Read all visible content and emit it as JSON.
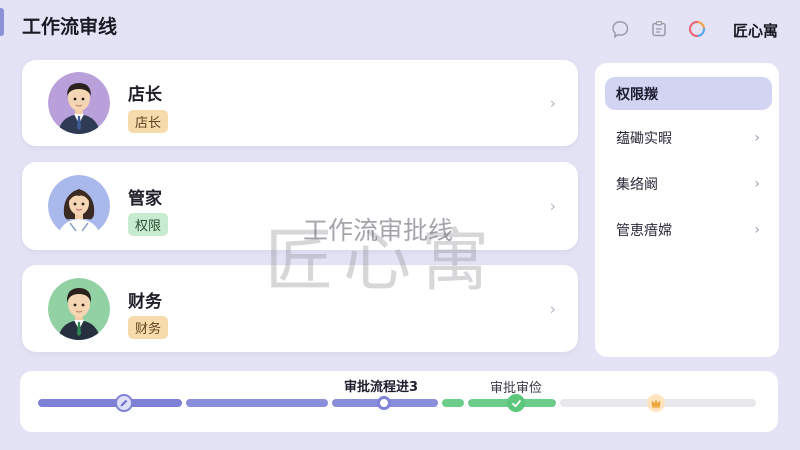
{
  "app_title": "工作流审线",
  "brand": "匠心寓",
  "header_icons": [
    "chat-bubble-icon",
    "clipboard-icon",
    "loop-icon"
  ],
  "roles": [
    {
      "name": "店长",
      "badge": "店长",
      "badge_color": "orange",
      "avatar": "manager-avatar"
    },
    {
      "name": "管家",
      "badge": "权限",
      "badge_color": "green",
      "avatar": "housekeeper-avatar"
    },
    {
      "name": "财务",
      "badge": "财务",
      "badge_color": "orange",
      "avatar": "finance-avatar"
    }
  ],
  "sidebar": {
    "items": [
      {
        "label": "权限羰",
        "active": true
      },
      {
        "label": "蕴磡实暇",
        "active": false
      },
      {
        "label": "集络阚",
        "active": false
      },
      {
        "label": "管恵瘖嫦",
        "active": false
      }
    ]
  },
  "watermark": {
    "sub": "工作流审批线",
    "main": "匠心寓"
  },
  "progress": {
    "label_main": "审批流程进3",
    "label_secondary": "审批审俭"
  },
  "colors": {
    "accent": "#7e81d6",
    "success": "#5cc77d",
    "background": "#e3e3f5",
    "badge_orange": "#f6dbac",
    "badge_green": "#c7ebcf"
  }
}
